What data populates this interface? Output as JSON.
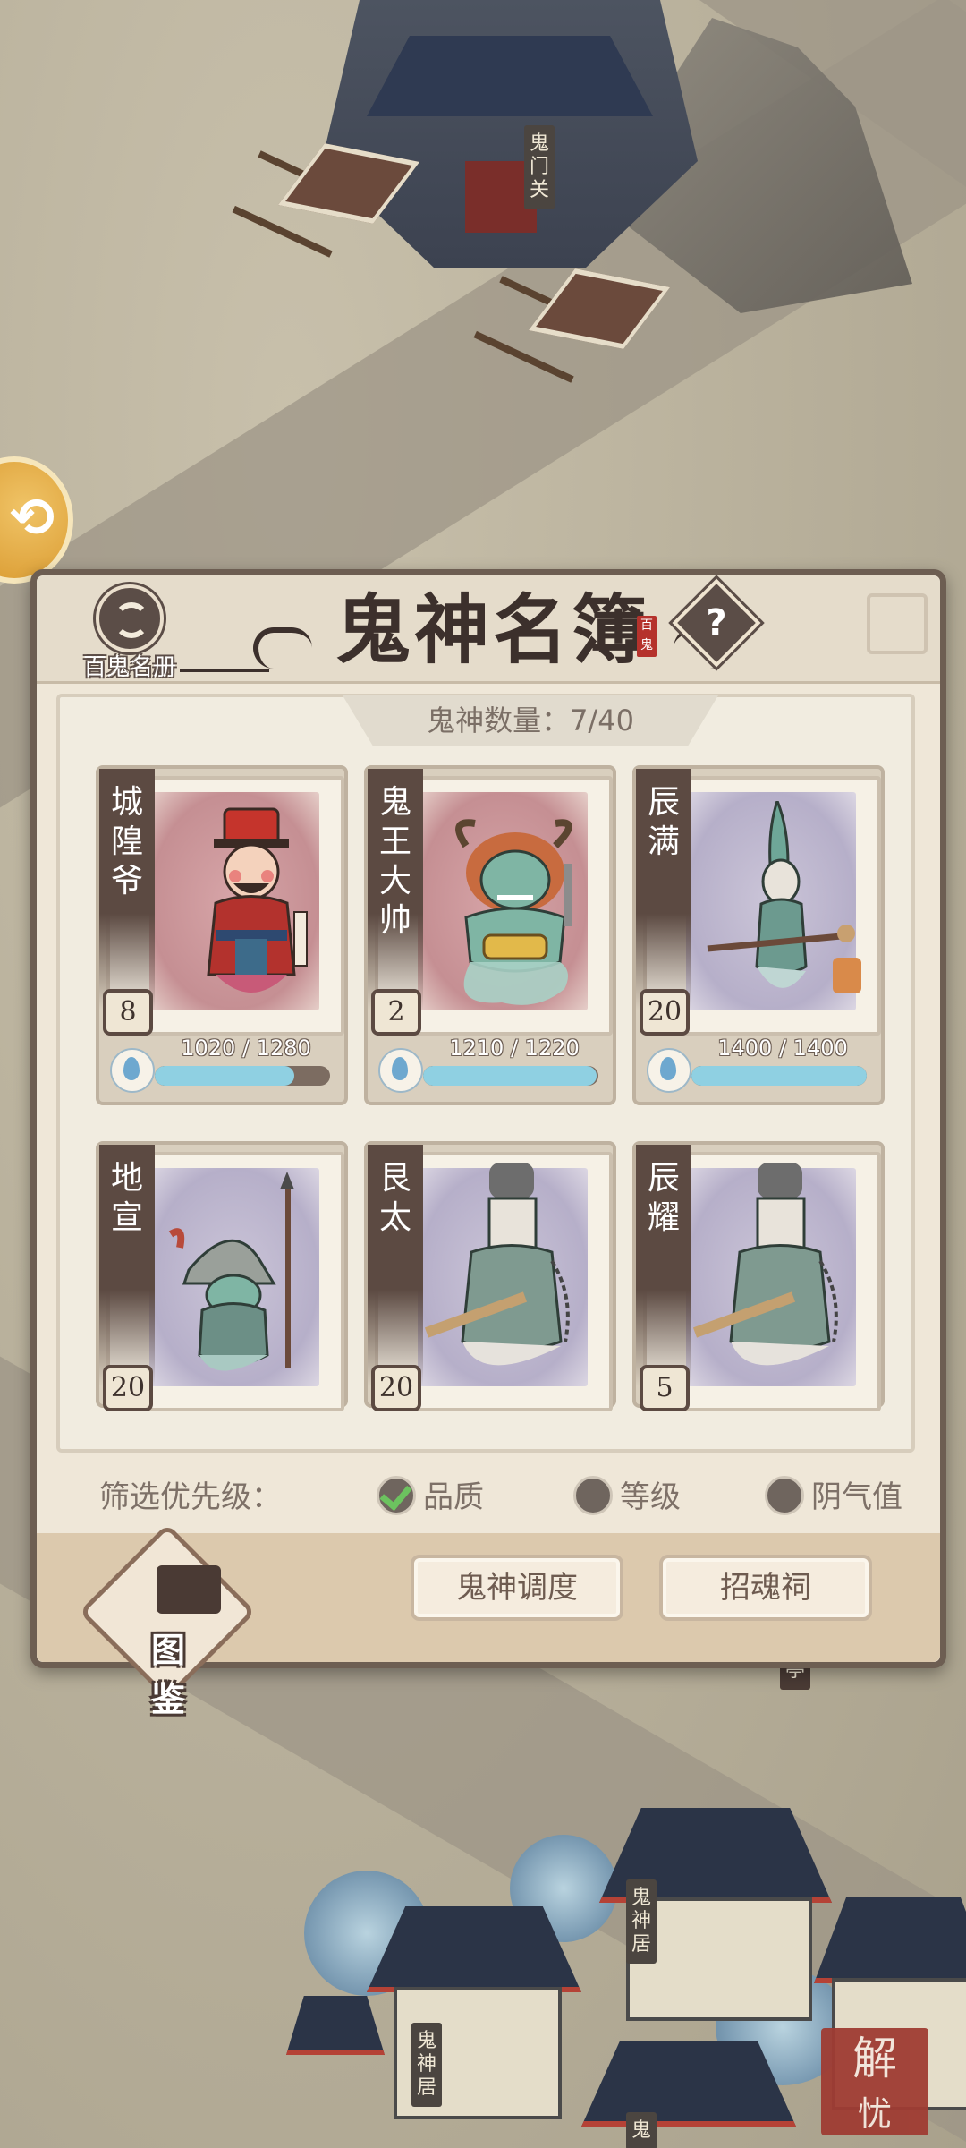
{
  "scene": {
    "gate_sign": "鬼门关",
    "building_sign_1": "鬼神居",
    "building_sign_2": "鬼神居",
    "building_sign_3": "鬼",
    "pavilion_sign": "亭",
    "corner_stamp": [
      "解",
      "忧"
    ]
  },
  "dialog": {
    "title": "鬼神名簿",
    "seal_text": "百鬼",
    "roster_label": "百鬼名册",
    "help_symbol": "?",
    "count_label": "鬼神数量：7/40",
    "cards": [
      {
        "name": "城隍爷",
        "level": "8",
        "hp_text": "1020 / 1280",
        "hp_fraction": 0.797,
        "bg": "red"
      },
      {
        "name": "鬼王大帅",
        "level": "2",
        "hp_text": "1210 / 1220",
        "hp_fraction": 0.992,
        "bg": "red"
      },
      {
        "name": "辰满",
        "level": "20",
        "hp_text": "1400 / 1400",
        "hp_fraction": 1.0,
        "bg": "purple"
      },
      {
        "name": "地宣",
        "level": "20",
        "bg": "purple"
      },
      {
        "name": "艮太",
        "level": "20",
        "bg": "purple"
      },
      {
        "name": "辰耀",
        "level": "5",
        "bg": "purple"
      }
    ],
    "filter": {
      "label": "筛选优先级：",
      "options": [
        {
          "label": "品质",
          "selected": true
        },
        {
          "label": "等级",
          "selected": false
        },
        {
          "label": "阴气值",
          "selected": false
        }
      ]
    },
    "footer": {
      "codex_label": "图鉴",
      "dispatch_button": "鬼神调度",
      "summon_button": "招魂祠"
    }
  },
  "colors": {
    "panel_border": "#6d5e52",
    "hp_fill": "#8fd0e2",
    "check_green": "#6cc25f",
    "stamp_red": "#9f3c33"
  }
}
